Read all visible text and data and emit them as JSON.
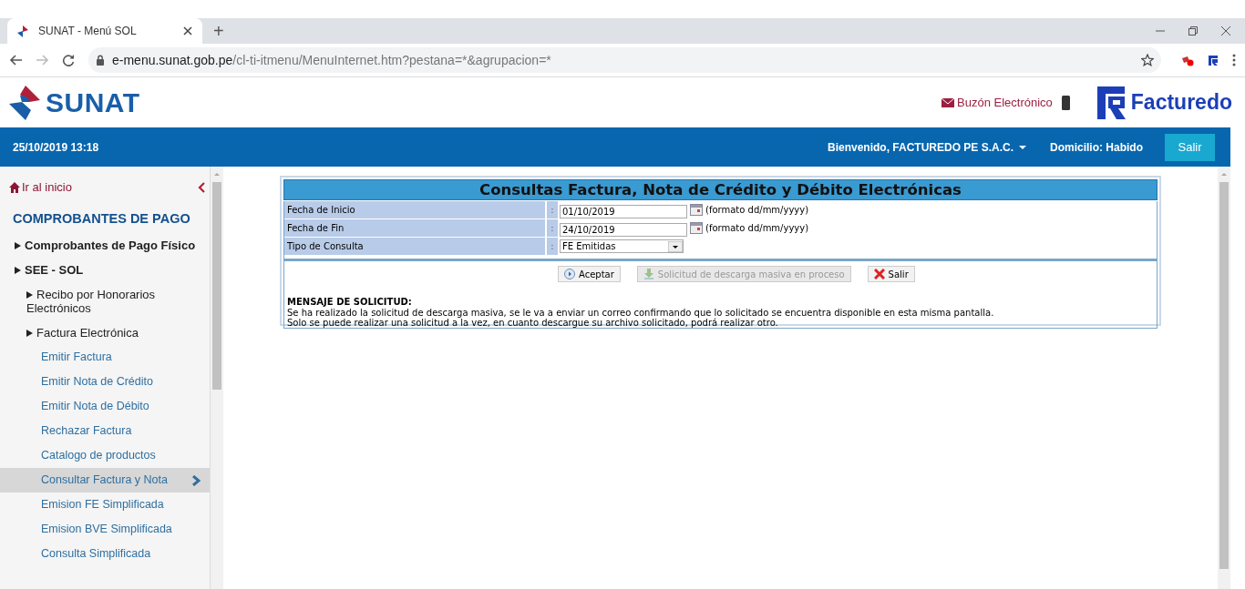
{
  "browser": {
    "tab_title": "SUNAT - Menú SOL",
    "new_tab": "+",
    "url_host": "e-menu.sunat.gob.pe",
    "url_path": "/cl-ti-itmenu/MenuInternet.htm?pestana=*&agrupacion=*"
  },
  "header": {
    "logo": "SUNAT",
    "mailbox": "Buzón Electrónico",
    "brand": "Facturedo"
  },
  "topbar": {
    "datetime": "25/10/2019 13:18",
    "user": "Bienvenido, FACTUREDO PE S.A.C.",
    "address_status": "Domicilio: Habido",
    "logout": "Salir"
  },
  "sidebar": {
    "home": "Ir al inicio",
    "heading": "COMPROBANTES DE PAGO",
    "items": [
      {
        "label": "Comprobantes de Pago Físico"
      },
      {
        "label": "SEE - SOL",
        "children": [
          {
            "label": "Recibo por Honorarios Electrónicos"
          },
          {
            "label": "Factura Electrónica",
            "children": [
              {
                "label": "Emitir Factura",
                "selected": false
              },
              {
                "label": "Emitir Nota de Crédito",
                "selected": false
              },
              {
                "label": "Emitir Nota de Débito",
                "selected": false
              },
              {
                "label": "Rechazar Factura",
                "selected": false
              },
              {
                "label": "Catalogo de productos",
                "selected": false
              },
              {
                "label": "Consultar Factura y Nota",
                "selected": true
              },
              {
                "label": "Emision FE Simplificada",
                "selected": false
              },
              {
                "label": "Emision BVE Simplificada",
                "selected": false
              },
              {
                "label": "Consulta Simplificada",
                "selected": false
              }
            ]
          }
        ]
      }
    ]
  },
  "form": {
    "title": "Consultas Factura, Nota de Crédito y Débito Electrónicas",
    "fields": [
      {
        "kind": "date",
        "label": "Fecha de Inicio",
        "separator": ":",
        "value": "01/10/2019",
        "hint": "(formato dd/mm/yyyy)"
      },
      {
        "kind": "date",
        "label": "Fecha de Fin",
        "separator": ":",
        "value": "24/10/2019",
        "hint": "(formato dd/mm/yyyy)"
      },
      {
        "kind": "select",
        "label": "Tipo de Consulta",
        "separator": ":",
        "value": "FE Emitidas"
      }
    ],
    "buttons": [
      {
        "kind": "accept",
        "label": "Aceptar",
        "disabled": false
      },
      {
        "kind": "download",
        "label": "Solicitud de descarga masiva en proceso",
        "disabled": true
      },
      {
        "kind": "exit",
        "label": "Salir",
        "disabled": false
      }
    ],
    "message_heading": "MENSAJE DE SOLICITUD:",
    "message_lines": [
      "Se ha realizado la solicitud de descarga masiva, se le va a enviar un correo confirmando que lo solicitado se encuentra disponible en esta misma pantalla.",
      "Solo se puede realizar una solicitud a la vez, en cuanto descargue su archivo solicitado, podrá realizar otro."
    ]
  }
}
